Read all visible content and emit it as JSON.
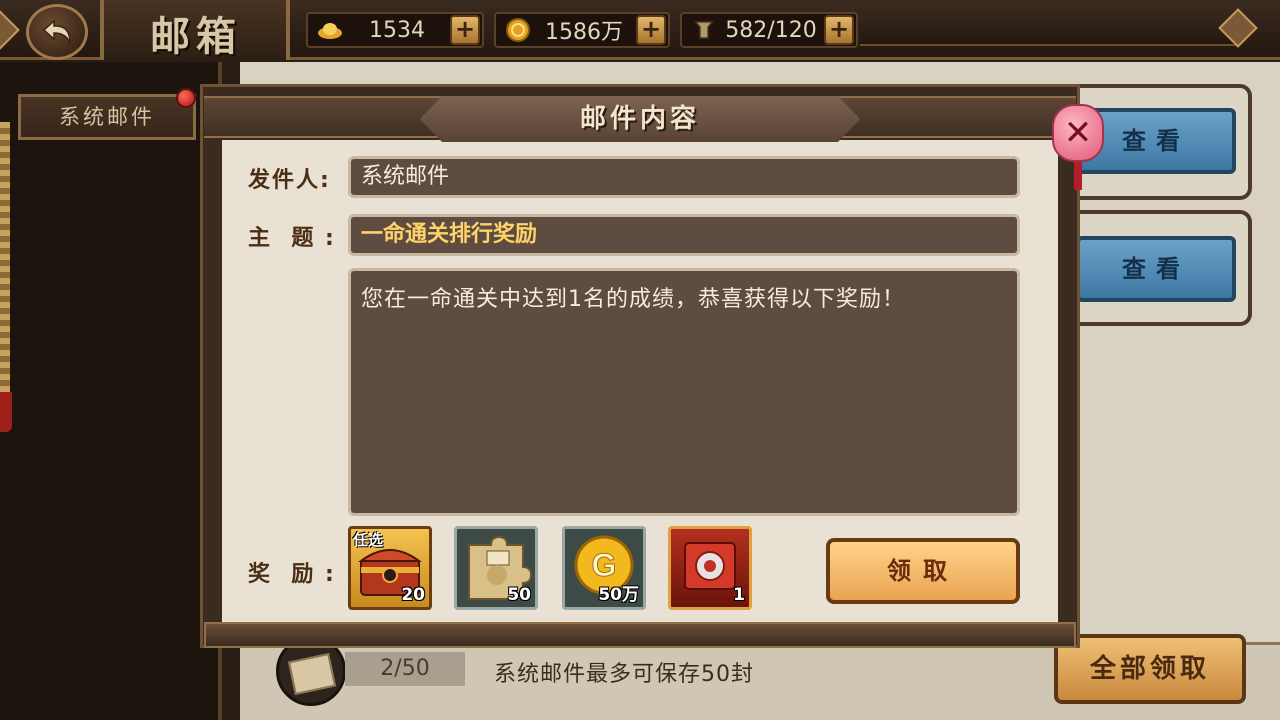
{
  "header": {
    "title": "邮箱",
    "back_icon": "back-arrow-icon"
  },
  "resources": [
    {
      "icon": "gold-ingot-icon",
      "value": "1534"
    },
    {
      "icon": "coin-icon",
      "value": "1586万"
    },
    {
      "icon": "stamina-icon",
      "value": "582/120"
    }
  ],
  "sidebar": {
    "tab_label": "系统邮件"
  },
  "mail_list": {
    "view_label": "查看",
    "count": "2/50",
    "tip": "系统邮件最多可保存50封",
    "claim_all_label": "全部领取"
  },
  "dialog": {
    "title": "邮件内容",
    "sender_label": "发件人:",
    "sender_value": "系统邮件",
    "subject_label": "主  题 :",
    "subject_value": "一命通关排行奖励",
    "message": "您在一命通关中达到1名的成绩，恭喜获得以下奖励！",
    "rewards_label": "奖  励 :",
    "rewards": [
      {
        "icon": "treasure-chest-icon",
        "tag": "任选",
        "qty": "20"
      },
      {
        "icon": "recruit-puzzle-icon",
        "tag": "",
        "qty": "50"
      },
      {
        "icon": "gold-coin-icon",
        "tag": "",
        "qty": "50万"
      },
      {
        "icon": "red-scroll-icon",
        "tag": "",
        "qty": "1"
      }
    ],
    "claim_label": "领取",
    "close_icon": "close-x-icon"
  },
  "colors": {
    "accent_gold": "#ffd36a",
    "panel_dark": "#5e4c40",
    "view_button_blue": "#4e88b5",
    "claim_button_orange": "#f0b060"
  }
}
